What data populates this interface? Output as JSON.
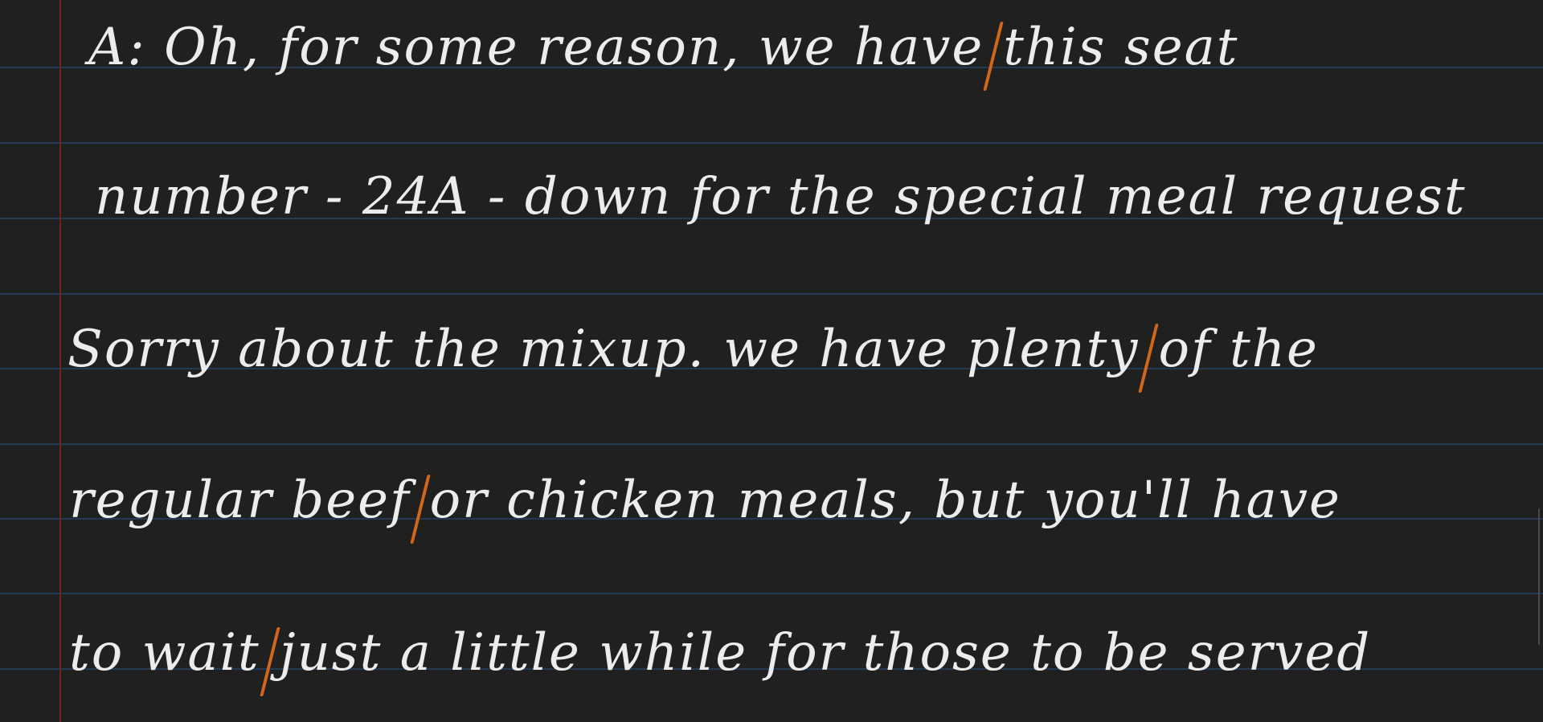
{
  "page": {
    "background_color": "#212020",
    "rule_color": "#243a52",
    "margin_color": "#7a1e1e",
    "ink_color": "#ececec",
    "pause_mark_color": "#d4661c"
  },
  "lines": [
    {
      "segments": [
        "A:  Oh, for some  reason, we have",
        "this seat"
      ]
    },
    {
      "segments": [
        "number  - 24A -  down for  the special meal request"
      ]
    },
    {
      "segments": [
        "Sorry about the mixup. we  have plenty",
        "of the"
      ]
    },
    {
      "segments": [
        "regular  beef",
        "or  chicken  meals,  but you'll  have"
      ]
    },
    {
      "segments": [
        "to wait",
        "just  a little  while  for those  to be served"
      ]
    }
  ]
}
